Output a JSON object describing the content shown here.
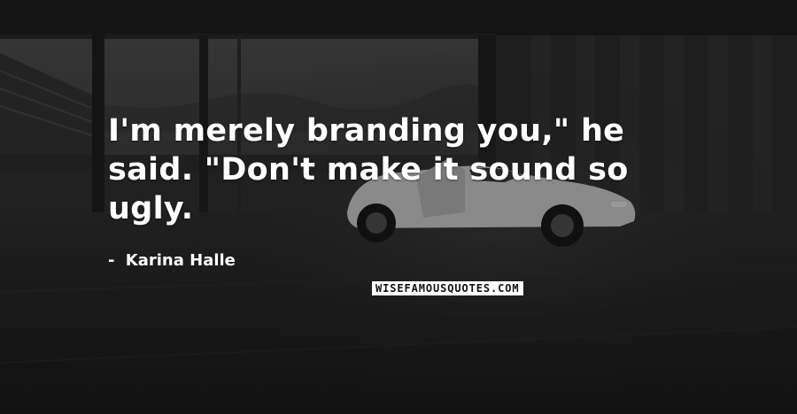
{
  "quote": {
    "line1": "I'm merely branding you,\" he",
    "line2": "said. \"Don't make it sound so",
    "line3": "ugly."
  },
  "author": {
    "dash": "-",
    "name": "Karina Halle"
  },
  "watermark": {
    "text": "WISEFAMOUSQUOTES.COM"
  },
  "colors": {
    "text": "#ffffff",
    "watermark_bg": "#ffffff",
    "watermark_text": "#111111",
    "background": "#1d1d1d"
  }
}
